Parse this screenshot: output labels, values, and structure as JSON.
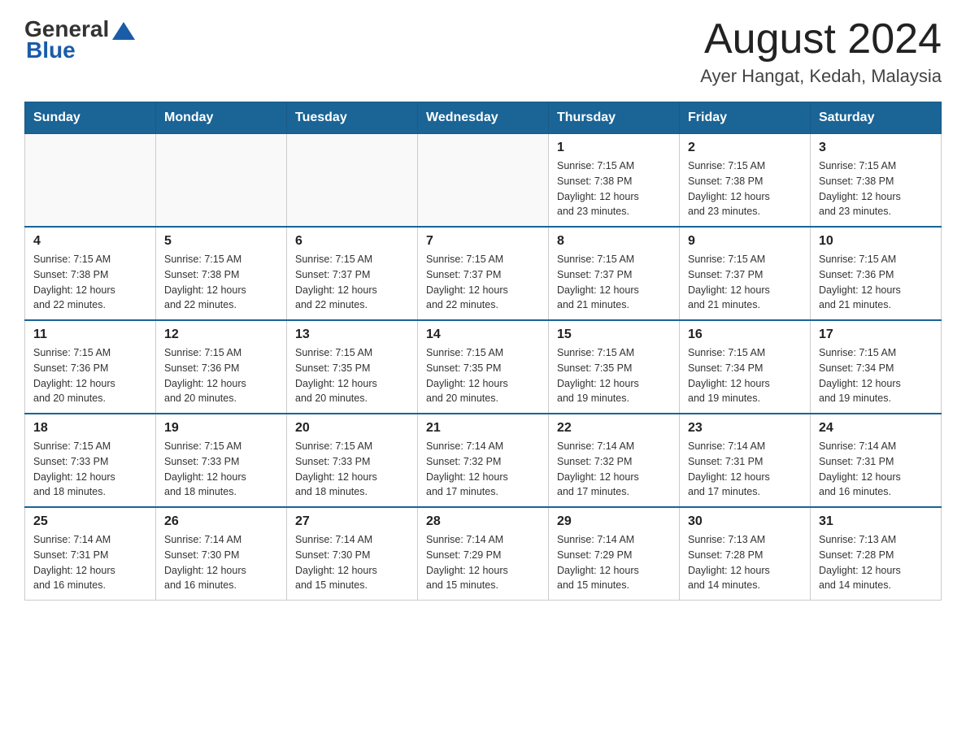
{
  "header": {
    "logo_general": "General",
    "logo_blue": "Blue",
    "title": "August 2024",
    "subtitle": "Ayer Hangat, Kedah, Malaysia"
  },
  "calendar": {
    "days_of_week": [
      "Sunday",
      "Monday",
      "Tuesday",
      "Wednesday",
      "Thursday",
      "Friday",
      "Saturday"
    ],
    "weeks": [
      [
        {
          "day": "",
          "info": ""
        },
        {
          "day": "",
          "info": ""
        },
        {
          "day": "",
          "info": ""
        },
        {
          "day": "",
          "info": ""
        },
        {
          "day": "1",
          "info": "Sunrise: 7:15 AM\nSunset: 7:38 PM\nDaylight: 12 hours\nand 23 minutes."
        },
        {
          "day": "2",
          "info": "Sunrise: 7:15 AM\nSunset: 7:38 PM\nDaylight: 12 hours\nand 23 minutes."
        },
        {
          "day": "3",
          "info": "Sunrise: 7:15 AM\nSunset: 7:38 PM\nDaylight: 12 hours\nand 23 minutes."
        }
      ],
      [
        {
          "day": "4",
          "info": "Sunrise: 7:15 AM\nSunset: 7:38 PM\nDaylight: 12 hours\nand 22 minutes."
        },
        {
          "day": "5",
          "info": "Sunrise: 7:15 AM\nSunset: 7:38 PM\nDaylight: 12 hours\nand 22 minutes."
        },
        {
          "day": "6",
          "info": "Sunrise: 7:15 AM\nSunset: 7:37 PM\nDaylight: 12 hours\nand 22 minutes."
        },
        {
          "day": "7",
          "info": "Sunrise: 7:15 AM\nSunset: 7:37 PM\nDaylight: 12 hours\nand 22 minutes."
        },
        {
          "day": "8",
          "info": "Sunrise: 7:15 AM\nSunset: 7:37 PM\nDaylight: 12 hours\nand 21 minutes."
        },
        {
          "day": "9",
          "info": "Sunrise: 7:15 AM\nSunset: 7:37 PM\nDaylight: 12 hours\nand 21 minutes."
        },
        {
          "day": "10",
          "info": "Sunrise: 7:15 AM\nSunset: 7:36 PM\nDaylight: 12 hours\nand 21 minutes."
        }
      ],
      [
        {
          "day": "11",
          "info": "Sunrise: 7:15 AM\nSunset: 7:36 PM\nDaylight: 12 hours\nand 20 minutes."
        },
        {
          "day": "12",
          "info": "Sunrise: 7:15 AM\nSunset: 7:36 PM\nDaylight: 12 hours\nand 20 minutes."
        },
        {
          "day": "13",
          "info": "Sunrise: 7:15 AM\nSunset: 7:35 PM\nDaylight: 12 hours\nand 20 minutes."
        },
        {
          "day": "14",
          "info": "Sunrise: 7:15 AM\nSunset: 7:35 PM\nDaylight: 12 hours\nand 20 minutes."
        },
        {
          "day": "15",
          "info": "Sunrise: 7:15 AM\nSunset: 7:35 PM\nDaylight: 12 hours\nand 19 minutes."
        },
        {
          "day": "16",
          "info": "Sunrise: 7:15 AM\nSunset: 7:34 PM\nDaylight: 12 hours\nand 19 minutes."
        },
        {
          "day": "17",
          "info": "Sunrise: 7:15 AM\nSunset: 7:34 PM\nDaylight: 12 hours\nand 19 minutes."
        }
      ],
      [
        {
          "day": "18",
          "info": "Sunrise: 7:15 AM\nSunset: 7:33 PM\nDaylight: 12 hours\nand 18 minutes."
        },
        {
          "day": "19",
          "info": "Sunrise: 7:15 AM\nSunset: 7:33 PM\nDaylight: 12 hours\nand 18 minutes."
        },
        {
          "day": "20",
          "info": "Sunrise: 7:15 AM\nSunset: 7:33 PM\nDaylight: 12 hours\nand 18 minutes."
        },
        {
          "day": "21",
          "info": "Sunrise: 7:14 AM\nSunset: 7:32 PM\nDaylight: 12 hours\nand 17 minutes."
        },
        {
          "day": "22",
          "info": "Sunrise: 7:14 AM\nSunset: 7:32 PM\nDaylight: 12 hours\nand 17 minutes."
        },
        {
          "day": "23",
          "info": "Sunrise: 7:14 AM\nSunset: 7:31 PM\nDaylight: 12 hours\nand 17 minutes."
        },
        {
          "day": "24",
          "info": "Sunrise: 7:14 AM\nSunset: 7:31 PM\nDaylight: 12 hours\nand 16 minutes."
        }
      ],
      [
        {
          "day": "25",
          "info": "Sunrise: 7:14 AM\nSunset: 7:31 PM\nDaylight: 12 hours\nand 16 minutes."
        },
        {
          "day": "26",
          "info": "Sunrise: 7:14 AM\nSunset: 7:30 PM\nDaylight: 12 hours\nand 16 minutes."
        },
        {
          "day": "27",
          "info": "Sunrise: 7:14 AM\nSunset: 7:30 PM\nDaylight: 12 hours\nand 15 minutes."
        },
        {
          "day": "28",
          "info": "Sunrise: 7:14 AM\nSunset: 7:29 PM\nDaylight: 12 hours\nand 15 minutes."
        },
        {
          "day": "29",
          "info": "Sunrise: 7:14 AM\nSunset: 7:29 PM\nDaylight: 12 hours\nand 15 minutes."
        },
        {
          "day": "30",
          "info": "Sunrise: 7:13 AM\nSunset: 7:28 PM\nDaylight: 12 hours\nand 14 minutes."
        },
        {
          "day": "31",
          "info": "Sunrise: 7:13 AM\nSunset: 7:28 PM\nDaylight: 12 hours\nand 14 minutes."
        }
      ]
    ]
  }
}
